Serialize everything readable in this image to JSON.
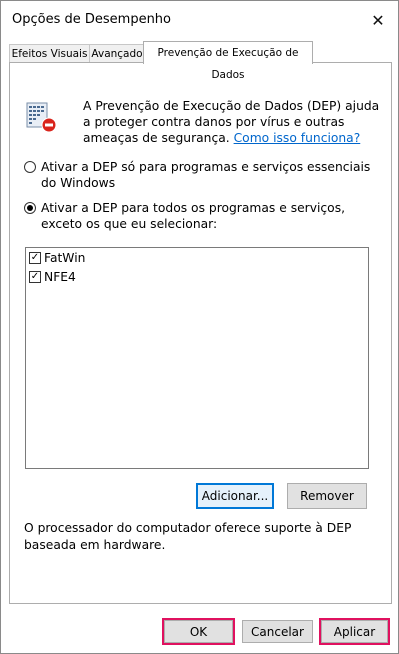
{
  "window": {
    "title": "Opções de Desempenho",
    "close_glyph": "✕"
  },
  "tabs": [
    {
      "label": "Efeitos Visuais"
    },
    {
      "label": "Avançado"
    },
    {
      "label": "Prevenção de Execução de Dados",
      "active": true
    }
  ],
  "dep": {
    "icon": "dep-shield-icon",
    "intro_text": "A Prevenção de Execução de Dados (DEP) ajuda a proteger contra danos por vírus e outras ameaças de segurança.",
    "link_text": "Como isso funciona?"
  },
  "options": {
    "essential": {
      "label": "Ativar a DEP só para programas e serviços essenciais do Windows",
      "selected": false
    },
    "all_except": {
      "label": "Ativar a DEP para todos os programas e serviços, exceto os que eu selecionar:",
      "selected": true
    }
  },
  "exceptions": [
    {
      "name": "FatWin",
      "checked": true
    },
    {
      "name": "NFE4",
      "checked": true
    }
  ],
  "buttons": {
    "add": "Adicionar...",
    "remove": "Remover",
    "ok": "OK",
    "cancel": "Cancelar",
    "apply": "Aplicar"
  },
  "hardware_support_text": "O processador do computador oferece suporte à DEP baseada em hardware.",
  "checkbox_glyph": "✓",
  "colors": {
    "highlight": "#e0115f",
    "link": "#0066cc",
    "focus": "#0078d7"
  }
}
